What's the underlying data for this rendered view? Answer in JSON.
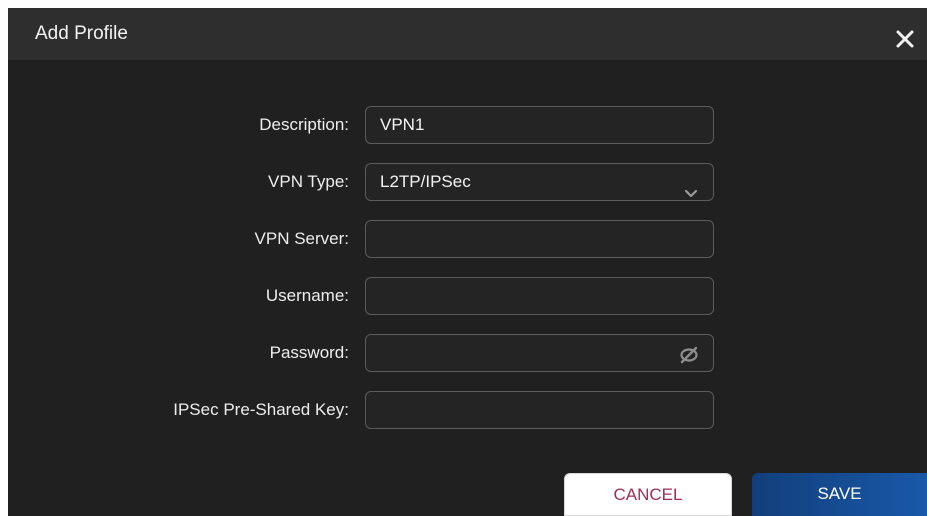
{
  "dialog": {
    "title": "Add Profile",
    "close_icon": "close-icon"
  },
  "form": {
    "description": {
      "label": "Description:",
      "value": "VPN1"
    },
    "vpn_type": {
      "label": "VPN Type:",
      "value": "L2TP/IPSec",
      "icon": "chevron-down-icon"
    },
    "vpn_server": {
      "label": "VPN Server:",
      "value": ""
    },
    "username": {
      "label": "Username:",
      "value": ""
    },
    "password": {
      "label": "Password:",
      "value": "",
      "icon": "eye-off-icon"
    },
    "ipsec_key": {
      "label": "IPSec Pre-Shared Key:",
      "value": ""
    }
  },
  "buttons": {
    "cancel": "CANCEL",
    "save": "SAVE"
  },
  "colors": {
    "dialog_background": "#202020",
    "header_background": "#2e2e2e",
    "field_border": "#5c5c5c",
    "cancel_text": "#9c2f56",
    "save_button": "#1958aa"
  }
}
